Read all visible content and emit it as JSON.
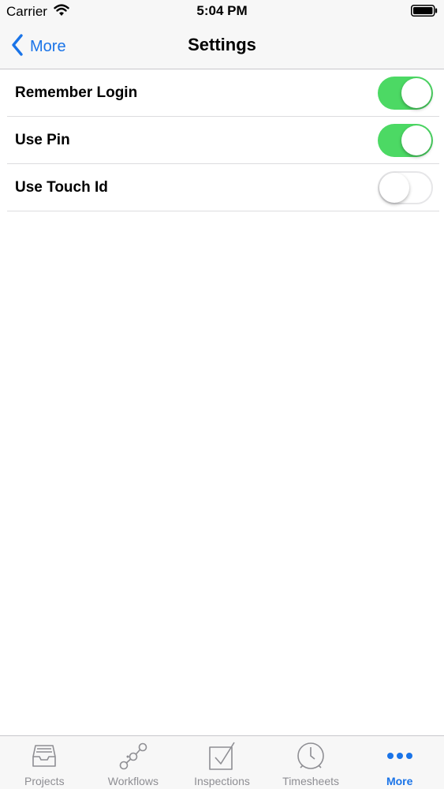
{
  "status_bar": {
    "carrier": "Carrier",
    "time": "5:04 PM"
  },
  "nav": {
    "back_label": "More",
    "title": "Settings"
  },
  "settings": [
    {
      "label": "Remember Login",
      "enabled": true
    },
    {
      "label": "Use Pin",
      "enabled": true
    },
    {
      "label": "Use Touch Id",
      "enabled": false
    }
  ],
  "tabs": [
    {
      "label": "Projects",
      "icon": "inbox-tray-icon",
      "active": false
    },
    {
      "label": "Workflows",
      "icon": "workflow-nodes-icon",
      "active": false
    },
    {
      "label": "Inspections",
      "icon": "checkbox-icon",
      "active": false
    },
    {
      "label": "Timesheets",
      "icon": "clock-icon",
      "active": false
    },
    {
      "label": "More",
      "icon": "more-dots-icon",
      "active": true
    }
  ],
  "colors": {
    "accent": "#1a74e8",
    "toggle_on": "#4cd964",
    "inactive_tab": "#8e8e93"
  }
}
